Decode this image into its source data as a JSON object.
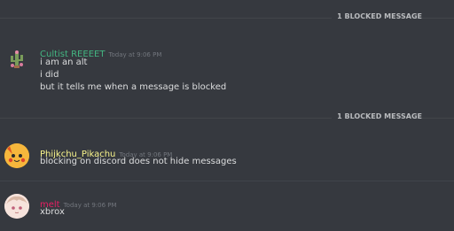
{
  "blocked_notices": [
    {
      "label": "1 BLOCKED MESSAGE"
    },
    {
      "label": "1 BLOCKED MESSAGE"
    }
  ],
  "messages": [
    {
      "author": "Cultist REEEET",
      "author_color": "#43b581",
      "timestamp": "Today at 9:06 PM",
      "lines": [
        "i am an alt",
        "i did",
        "but it tells me when a message is blocked"
      ],
      "avatar_icon": "cactus-avatar"
    },
    {
      "author": "Phijkchu_Pikachu",
      "author_color": "#faf58c",
      "timestamp": "Today at 9:06 PM",
      "lines": [
        "blocking on discord does not hide messages"
      ],
      "avatar_icon": "pikachu-avatar"
    },
    {
      "author": "melt",
      "author_color": "#e91e63",
      "timestamp": "Today at 9:06 PM",
      "lines": [
        "xbrox"
      ],
      "avatar_icon": "anime-girl-avatar"
    }
  ]
}
